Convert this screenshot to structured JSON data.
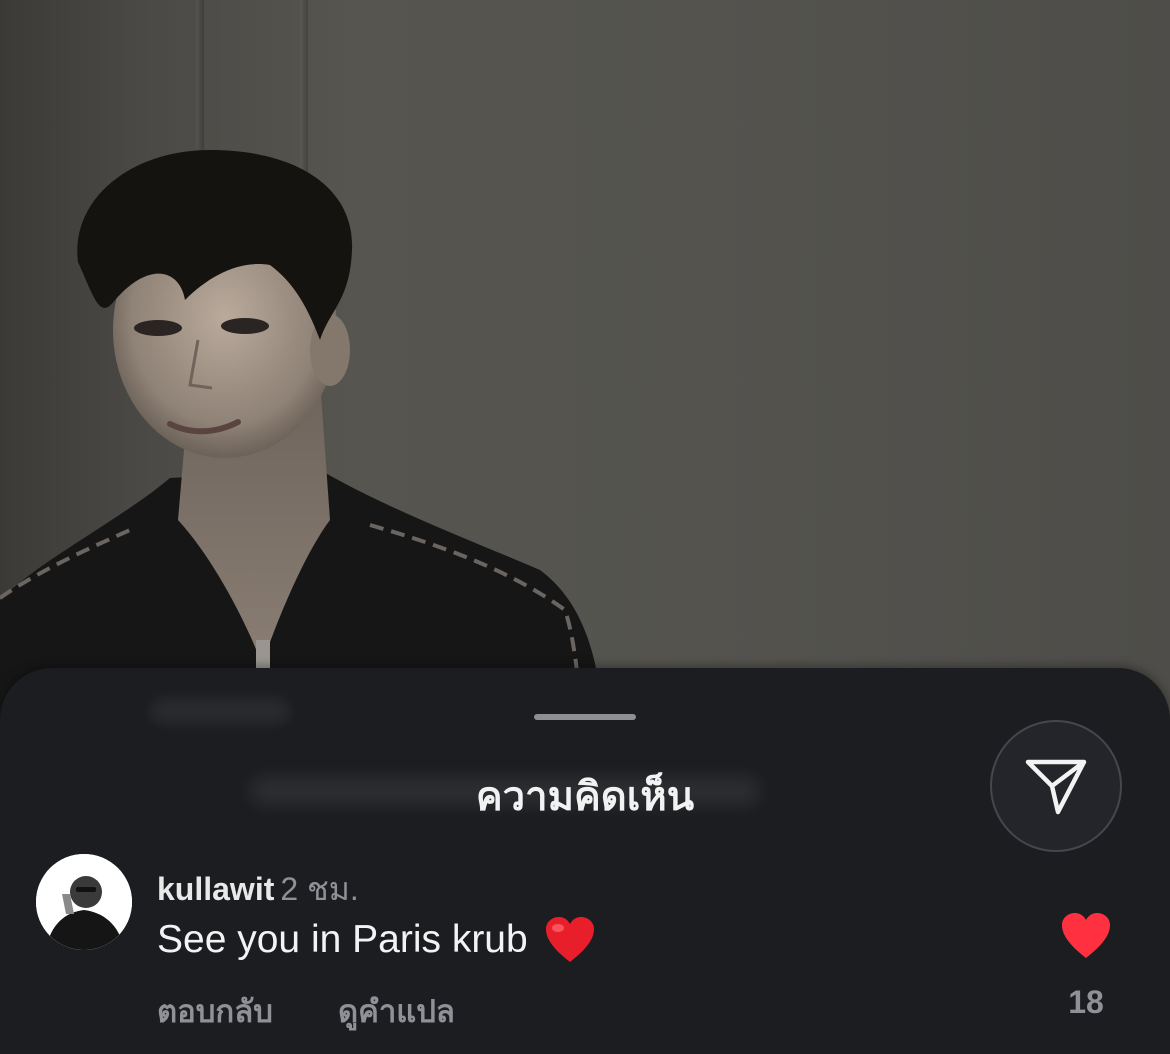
{
  "sheet": {
    "title": "ความคิดเห็น",
    "share_icon": "send-icon"
  },
  "comment": {
    "username": "kullawit",
    "time": "2 ชม.",
    "text": "See you in Paris krub",
    "emoji": "red-heart-emoji",
    "reply_label": "ตอบกลับ",
    "translate_label": "ดูคำแปล",
    "like_count": "18",
    "liked": true,
    "like_color": "#ff3040"
  },
  "colors": {
    "sheet_background": "#1b1d21",
    "secondary_text": "#8f9196",
    "primary_text": "#f3f3f4"
  }
}
